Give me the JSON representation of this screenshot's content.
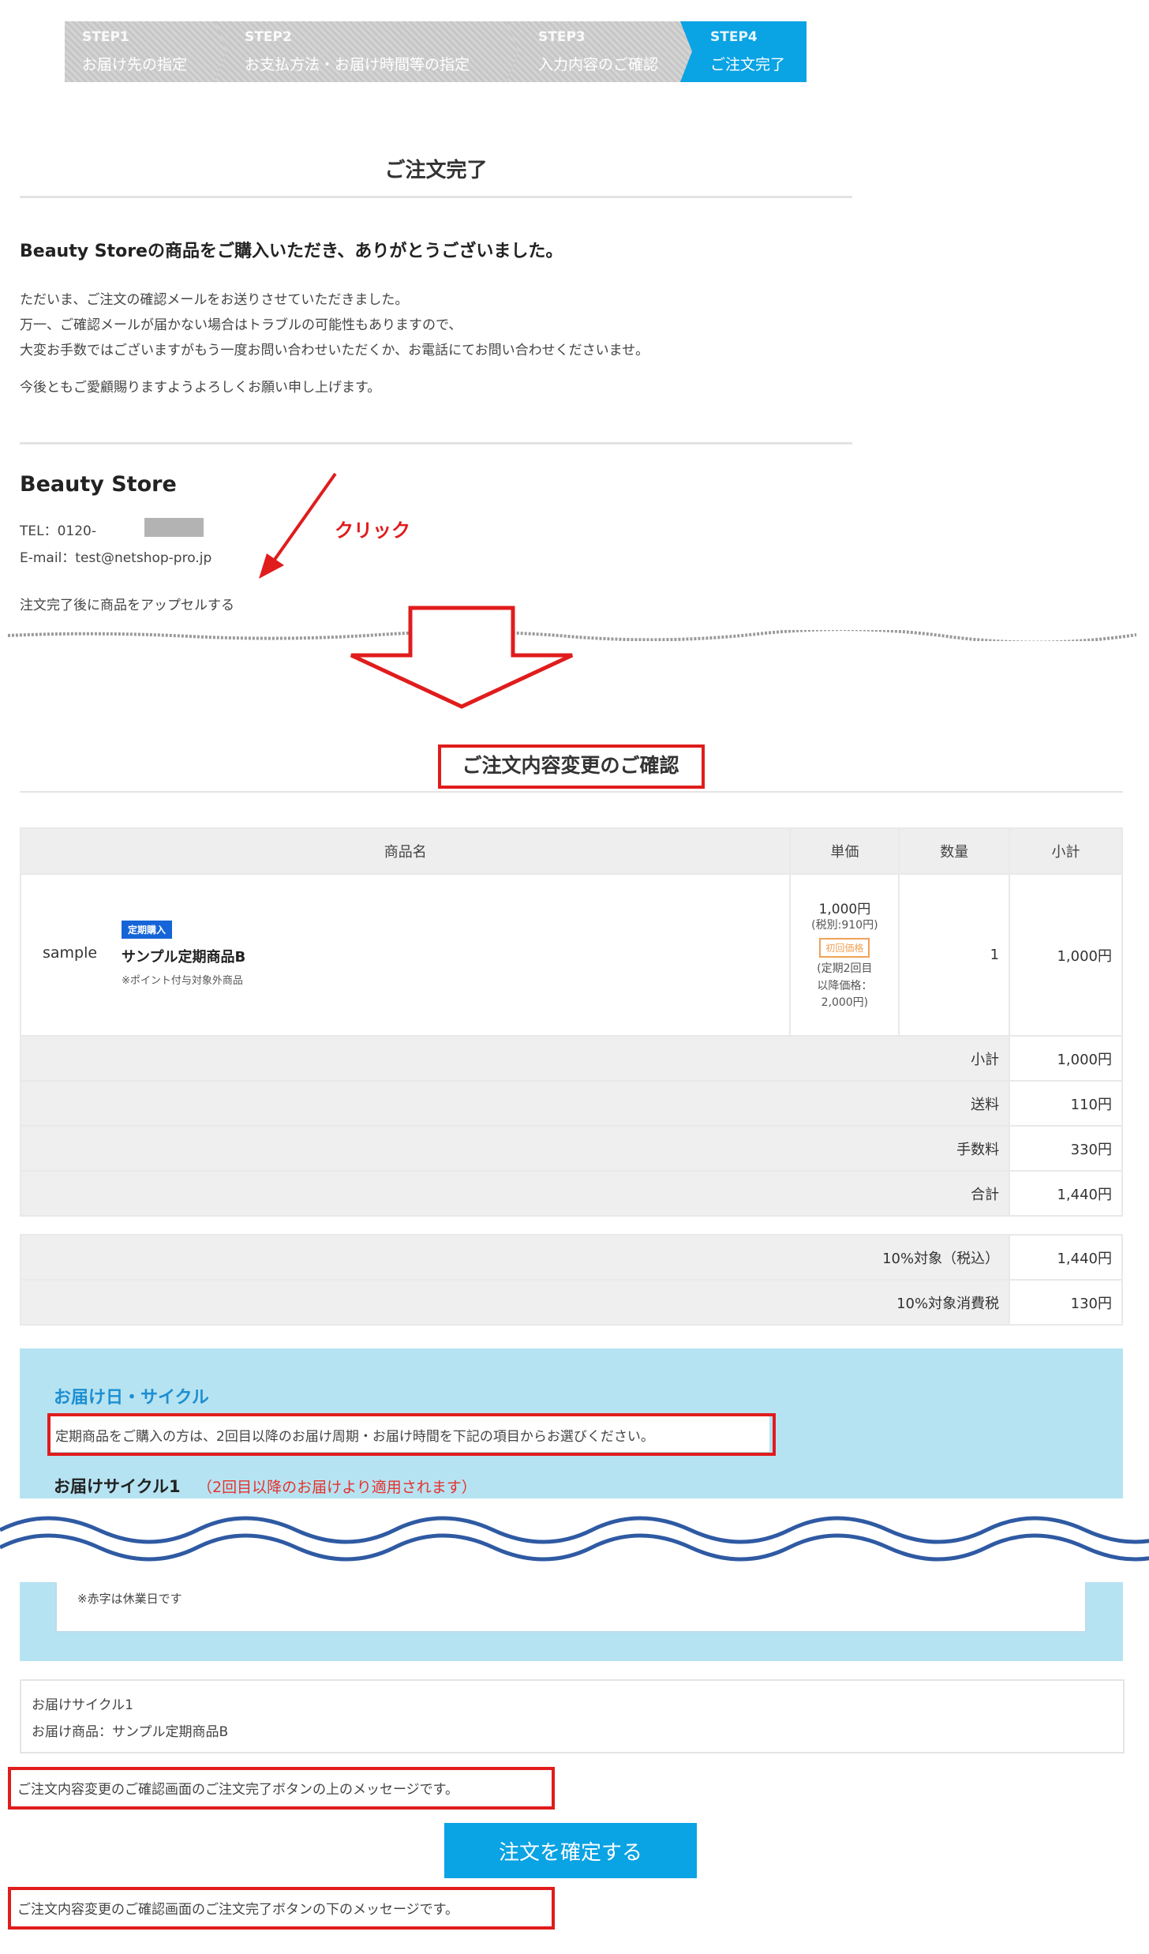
{
  "steps": [
    {
      "no": "STEP1",
      "label": "お届け先の指定"
    },
    {
      "no": "STEP2",
      "label": "お支払方法・お届け時間等の指定"
    },
    {
      "no": "STEP3",
      "label": "入力内容のご確認"
    },
    {
      "no": "STEP4",
      "label": "ご注文完了"
    }
  ],
  "complete": {
    "title": "ご注文完了",
    "thanks": "Beauty Storeの商品をご購入いただき、ありがとうございました。",
    "lines": [
      "ただいま、ご注文の確認メールをお送りさせていただきました。",
      "万一、ご確認メールが届かない場合はトラブルの可能性もありますので、",
      "大変お手数ではございますがもう一度お問い合わせいただくか、お電話にてお問い合わせくださいませ。"
    ],
    "closing": "今後ともご愛顧賜りますようよろしくお願い申し上げます。"
  },
  "store": {
    "name": "Beauty Store",
    "tel": "TEL：0120-",
    "email": "E-mail：test@netshop-pro.jp",
    "upsell_link": "注文完了後に商品をアップセルする"
  },
  "annotation": {
    "click": "クリック"
  },
  "confirm": {
    "title": "ご注文内容変更のご確認",
    "headers": {
      "name": "商品名",
      "price": "単価",
      "qty": "数量",
      "subtotal": "小計"
    },
    "item": {
      "image": "sample",
      "badge": "定期購入",
      "name": "サンプル定期商品B",
      "note": "※ポイント付与対象外商品",
      "price": "1,000円",
      "price_excl": "(税別:910円)",
      "first_badge": "初回価格",
      "later1": "(定期2回目",
      "later2": "以降価格：",
      "later3": "2,000円)",
      "qty": "1",
      "subtotal": "1,000円"
    },
    "totals": [
      {
        "label": "小計",
        "value": "1,000円"
      },
      {
        "label": "送料",
        "value": "110円"
      },
      {
        "label": "手数料",
        "value": "330円"
      },
      {
        "label": "合計",
        "value": "1,440円"
      }
    ],
    "tax": [
      {
        "label": "10%対象（税込）",
        "value": "1,440円"
      },
      {
        "label": "10%対象消費税",
        "value": "130円"
      }
    ]
  },
  "delivery": {
    "heading": "お届け日・サイクル",
    "desc": "定期商品をご購入の方は、2回目以降のお届け周期・お届け時間を下記の項目からお選びください。",
    "cycle_label": "お届けサイクル1",
    "cycle_note": "（2回目以降のお届けより適用されます）",
    "holiday_note": "※赤字は休業日です",
    "summary_cycle": "お届けサイクル1",
    "summary_item": "お届け商品：サンプル定期商品B"
  },
  "messages": {
    "above": "ご注文内容変更のご確認画面のご注文完了ボタンの上のメッセージです。",
    "below": "ご注文内容変更のご確認画面のご注文完了ボタンの下のメッセージです。",
    "confirm_button": "注文を確定する"
  },
  "colors": {
    "accent": "#0aa3e4",
    "highlight": "#e01c1c",
    "panel": "#b6e3f2",
    "badge": "#1565d8"
  }
}
